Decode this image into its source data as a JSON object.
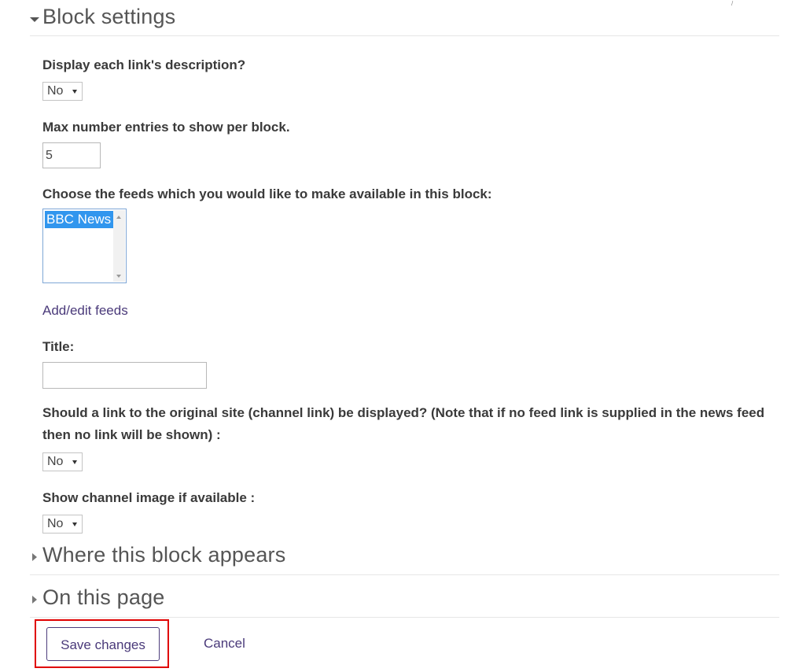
{
  "block_settings": {
    "title": "Block settings"
  },
  "fields": {
    "display_description": {
      "label": "Display each link's description?",
      "value": "No"
    },
    "max_entries": {
      "label": "Max number entries to show per block.",
      "value": "5"
    },
    "feeds": {
      "label": "Choose the feeds which you would like to make available in this block:",
      "options": [
        "BBC News"
      ],
      "selected": "BBC News"
    },
    "add_edit_feeds_link": "Add/edit feeds",
    "title": {
      "label": "Title:",
      "value": ""
    },
    "channel_link": {
      "label": "Should a link to the original site (channel link) be displayed? (Note that if no feed link is supplied in the news feed then no link will be shown) :",
      "value": "No"
    },
    "channel_image": {
      "label": "Show channel image if available :",
      "value": "No"
    }
  },
  "sections": {
    "where_appears": "Where this block appears",
    "on_this_page": "On this page"
  },
  "actions": {
    "save_label": "Save changes",
    "cancel_label": "Cancel"
  },
  "colors": {
    "link": "#4a3a7a",
    "selected_option": "#3196ee",
    "highlight": "#e00000"
  }
}
